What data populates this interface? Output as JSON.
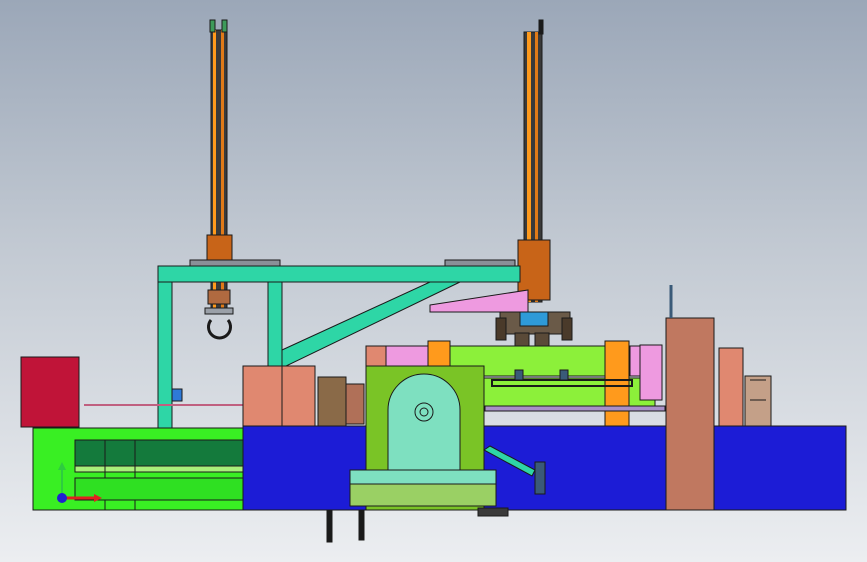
{
  "viewport": {
    "background_top": "#9ba7b8",
    "background_bottom": "#eceef1"
  },
  "colors": {
    "outline": "#1a1a1a",
    "base_blue": "#1c1cd6",
    "frame_teal": "#2ed6a6",
    "bright_green": "#39ef23",
    "lime": "#8cf03a",
    "olive_housing": "#7ac426",
    "mint_panel": "#7ee0c0",
    "salmon": "#e08870",
    "brown_tower": "#c07860",
    "crimson_box": "#c01438",
    "orange": "#ff9a1c",
    "pink": "#ee9ae0",
    "copper": "#c86418",
    "dark_green_panel": "#147a3c",
    "dark_blue_grey": "#3a5a78"
  },
  "icons": {
    "axis_triad": "coordinate-axis-triad-icon"
  }
}
